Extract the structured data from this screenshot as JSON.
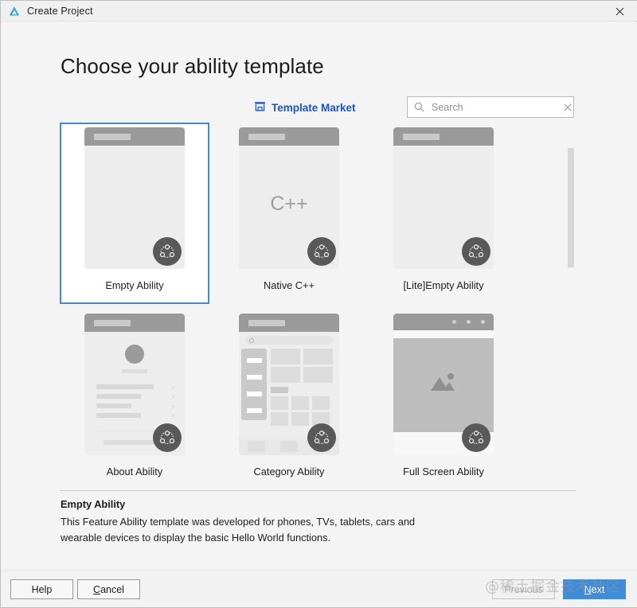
{
  "window": {
    "title": "Create Project",
    "app_icon": "deveco-logo-icon",
    "close_icon": "close-icon"
  },
  "heading": "Choose your ability template",
  "market": {
    "label": "Template Market",
    "icon": "store-icon",
    "accent_color": "#1455d8"
  },
  "search": {
    "value": "",
    "placeholder": "Search",
    "icon": "search-icon",
    "clear_icon": "clear-icon"
  },
  "templates": [
    {
      "label": "Empty Ability",
      "selected": true,
      "badge": "harmony-distributed-icon"
    },
    {
      "label": "Native C++",
      "selected": false,
      "badge": "harmony-distributed-icon",
      "glyph": "C++"
    },
    {
      "label": "[Lite]Empty Ability",
      "selected": false,
      "badge": "harmony-distributed-icon"
    },
    {
      "label": "About Ability",
      "selected": false,
      "badge": "harmony-distributed-icon"
    },
    {
      "label": "Category Ability",
      "selected": false,
      "badge": "harmony-distributed-icon"
    },
    {
      "label": "Full Screen Ability",
      "selected": false,
      "badge": "harmony-distributed-icon"
    }
  ],
  "description": {
    "title": "Empty Ability",
    "body": "This Feature Ability template was developed for phones, TVs, tablets, cars and wearable devices to display the basic Hello World functions."
  },
  "footer": {
    "help": "Help",
    "cancel_mnemonic": "C",
    "cancel_rest": "ancel",
    "previous": "Previous",
    "next_mnemonic": "N",
    "next_rest": "ext",
    "next_color": "#3f8cd8"
  },
  "watermark": "@稀土掘金技术社区",
  "scrollbar": {
    "thumb_color": "#d6d6d6"
  }
}
